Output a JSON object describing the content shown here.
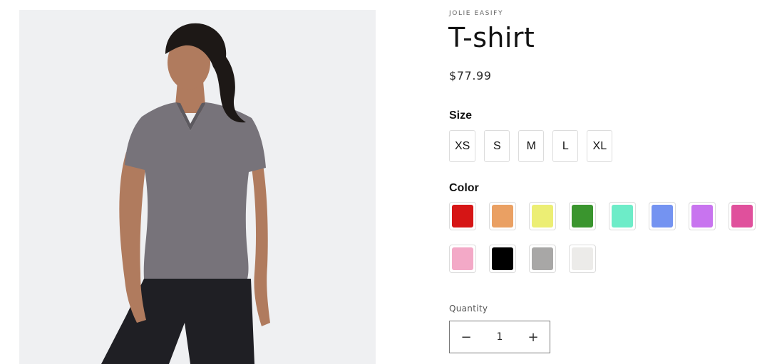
{
  "product": {
    "vendor": "JOLIE EASIFY",
    "title": "T-shirt",
    "price": "$77.99",
    "image_alt": "woman-wearing-gray-v-neck-t-shirt"
  },
  "size": {
    "label": "Size",
    "options": [
      "XS",
      "S",
      "M",
      "L",
      "XL"
    ]
  },
  "color": {
    "label": "Color",
    "swatches": [
      {
        "name": "red",
        "hex": "#d61515"
      },
      {
        "name": "orange",
        "hex": "#eaa063"
      },
      {
        "name": "yellow",
        "hex": "#ecee74"
      },
      {
        "name": "green",
        "hex": "#3a952e"
      },
      {
        "name": "mint",
        "hex": "#6decc8"
      },
      {
        "name": "blue",
        "hex": "#7493f1"
      },
      {
        "name": "purple",
        "hex": "#c874ef"
      },
      {
        "name": "pink",
        "hex": "#e0509c"
      },
      {
        "name": "light-pink",
        "hex": "#f3a9c7"
      },
      {
        "name": "black",
        "hex": "#000000"
      },
      {
        "name": "gray",
        "hex": "#a8a7a6"
      },
      {
        "name": "off-white",
        "hex": "#ecebe9"
      }
    ]
  },
  "quantity": {
    "label": "Quantity",
    "value": "1",
    "minus": "−",
    "plus": "+"
  }
}
